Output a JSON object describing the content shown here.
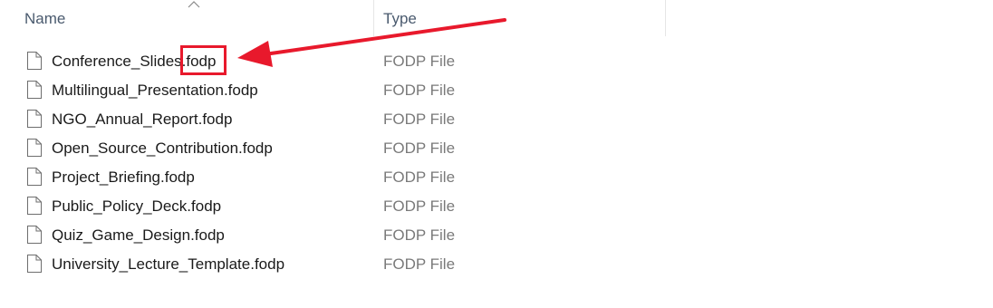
{
  "columns": {
    "name_label": "Name",
    "type_label": "Type",
    "sort_indicator": "caret-up-icon"
  },
  "files": [
    {
      "name": "Conference_Slides.fodp",
      "type": "FODP File"
    },
    {
      "name": "Multilingual_Presentation.fodp",
      "type": "FODP File"
    },
    {
      "name": "NGO_Annual_Report.fodp",
      "type": "FODP File"
    },
    {
      "name": "Open_Source_Contribution.fodp",
      "type": "FODP File"
    },
    {
      "name": "Project_Briefing.fodp",
      "type": "FODP File"
    },
    {
      "name": "Public_Policy_Deck.fodp",
      "type": "FODP File"
    },
    {
      "name": "Quiz_Game_Design.fodp",
      "type": "FODP File"
    },
    {
      "name": "University_Lecture_Template.fodp",
      "type": "FODP File"
    }
  ],
  "annotation": {
    "highlight_target": "fodp",
    "color": "#e8192c",
    "icon": "arrow-left-icon"
  },
  "colors": {
    "header_text": "#4a5a6e",
    "name_text": "#1a1a1a",
    "type_text": "#7a7a7a",
    "file_icon_stroke": "#6e6e6e"
  }
}
